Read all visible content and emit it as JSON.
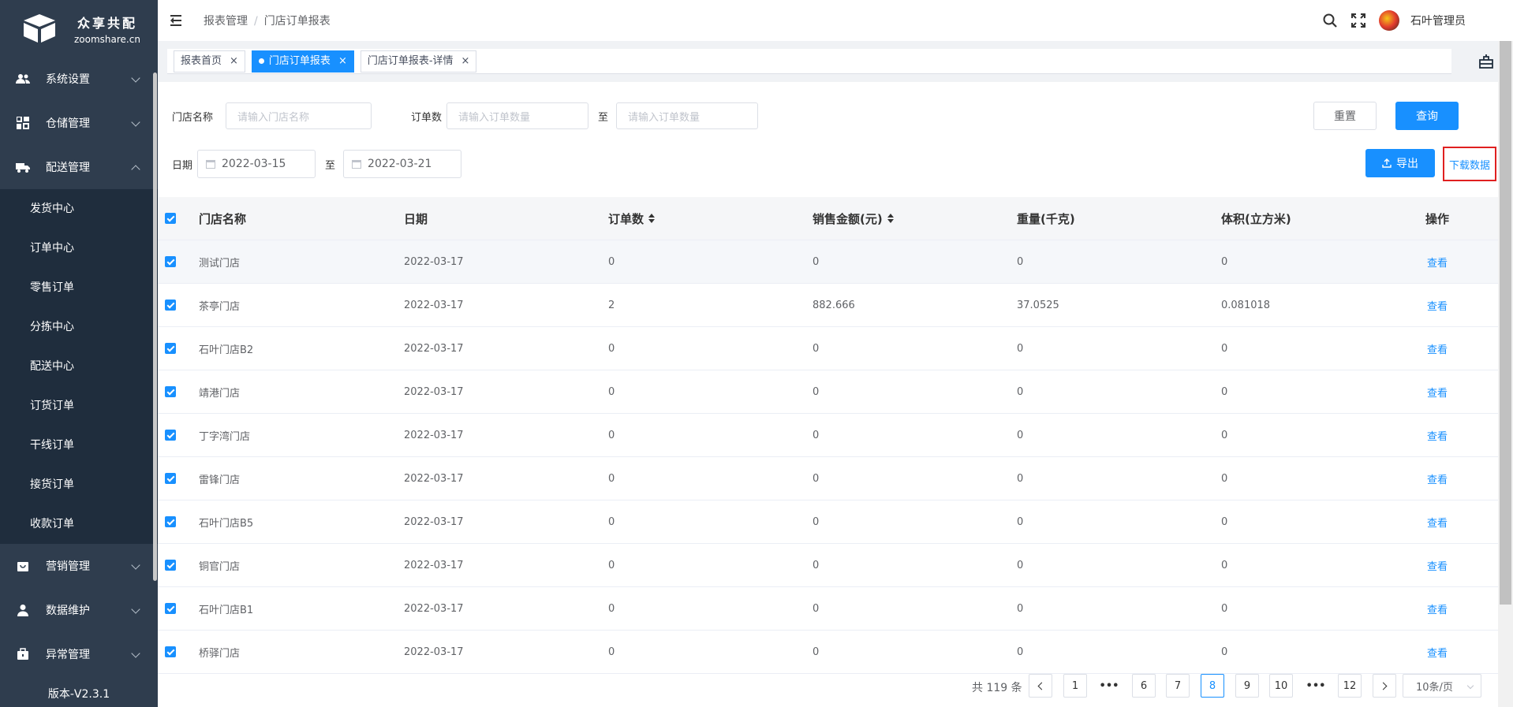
{
  "brand": {
    "name_cn": "众享共配",
    "name_en": "zoomshare.cn"
  },
  "sidebar": {
    "groups": [
      {
        "label": "系统设置",
        "icon": "users-icon"
      },
      {
        "label": "仓储管理",
        "icon": "grid-icon"
      },
      {
        "label": "配送管理",
        "icon": "truck-icon",
        "expanded": true
      }
    ],
    "submenu": [
      "发货中心",
      "订单中心",
      "零售订单",
      "分拣中心",
      "配送中心",
      "订货订单",
      "干线订单",
      "接货订单",
      "收款订单"
    ],
    "groups_after": [
      {
        "label": "营销管理",
        "icon": "bag-icon"
      },
      {
        "label": "数据维护",
        "icon": "user-icon"
      },
      {
        "label": "异常管理",
        "icon": "briefcase-icon"
      }
    ],
    "version": "版本-V2.3.1"
  },
  "header": {
    "breadcrumb": [
      "报表管理",
      "门店订单报表"
    ],
    "sep": "/",
    "username": "石叶管理员"
  },
  "tabs": [
    {
      "label": "报表首页",
      "active": false
    },
    {
      "label": "门店订单报表",
      "active": true
    },
    {
      "label": "门店订单报表-详情",
      "active": false
    }
  ],
  "tab_close": "×",
  "filters": {
    "store_label": "门店名称",
    "store_placeholder": "请输入门店名称",
    "orders_label": "订单数",
    "orders_min_placeholder": "请输入订单数量",
    "to": "至",
    "orders_max_placeholder": "请输入订单数量",
    "date_label": "日期",
    "date_start": "2022-03-15",
    "date_end": "2022-03-21",
    "reset": "重置",
    "search": "查询",
    "export": "导出",
    "download": "下载数据"
  },
  "table": {
    "headers": [
      "门店名称",
      "日期",
      "订单数",
      "销售金额(元)",
      "重量(千克)",
      "体积(立方米)",
      "操作"
    ],
    "action": "查看",
    "rows": [
      [
        "测试门店",
        "2022-03-17",
        "0",
        "0",
        "0",
        "0"
      ],
      [
        "茶亭门店",
        "2022-03-17",
        "2",
        "882.666",
        "37.0525",
        "0.081018"
      ],
      [
        "石叶门店B2",
        "2022-03-17",
        "0",
        "0",
        "0",
        "0"
      ],
      [
        "靖港门店",
        "2022-03-17",
        "0",
        "0",
        "0",
        "0"
      ],
      [
        "丁字湾门店",
        "2022-03-17",
        "0",
        "0",
        "0",
        "0"
      ],
      [
        "雷锋门店",
        "2022-03-17",
        "0",
        "0",
        "0",
        "0"
      ],
      [
        "石叶门店B5",
        "2022-03-17",
        "0",
        "0",
        "0",
        "0"
      ],
      [
        "铜官门店",
        "2022-03-17",
        "0",
        "0",
        "0",
        "0"
      ],
      [
        "石叶门店B1",
        "2022-03-17",
        "0",
        "0",
        "0",
        "0"
      ],
      [
        "桥驿门店",
        "2022-03-17",
        "0",
        "0",
        "0",
        "0"
      ]
    ]
  },
  "pagination": {
    "total": "共 119 条",
    "pages": [
      "1",
      "•••",
      "6",
      "7",
      "8",
      "9",
      "10",
      "•••",
      "12"
    ],
    "current": "8",
    "page_size": "10条/页"
  }
}
